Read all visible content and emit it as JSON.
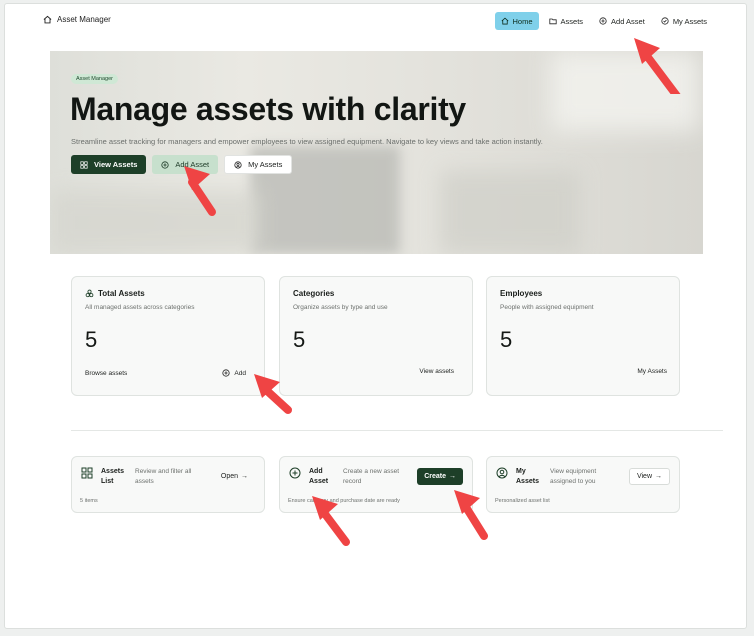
{
  "brand": {
    "name": "Asset Manager",
    "icon": "home-icon"
  },
  "nav": {
    "items": [
      {
        "label": "Home",
        "icon": "home-icon",
        "active": true
      },
      {
        "label": "Assets",
        "icon": "folder-icon",
        "active": false
      },
      {
        "label": "Add Asset",
        "icon": "plus-circle-icon",
        "active": false
      },
      {
        "label": "My Assets",
        "icon": "check-circle-icon",
        "active": false
      }
    ]
  },
  "hero": {
    "tag": "Asset Manager",
    "title": "Manage assets with clarity",
    "subtitle": "Streamline asset tracking for managers and empower employees to view assigned equipment. Navigate to key views and take action instantly.",
    "buttons": {
      "view_assets": "View Assets",
      "add_asset": "Add Asset",
      "my_assets": "My Assets"
    }
  },
  "stats": {
    "total": {
      "title": "Total Assets",
      "desc": "All managed assets across categories",
      "value": "5",
      "link": "Browse assets",
      "action": "Add"
    },
    "categories": {
      "title": "Categories",
      "desc": "Organize assets by type and use",
      "value": "5",
      "link": "View assets"
    },
    "employees": {
      "title": "Employees",
      "desc": "People with assigned equipment",
      "value": "5",
      "link": "My Assets"
    }
  },
  "quick": {
    "list": {
      "name": "Assets List",
      "text": "Review and filter all assets",
      "action": "Open",
      "note": "5 items"
    },
    "add": {
      "name": "Add Asset",
      "text": "Create a new asset record",
      "action": "Create",
      "note": "Ensure category and purchase date are ready"
    },
    "mine": {
      "name": "My Assets",
      "text": "View equipment assigned to you",
      "action": "View",
      "note": "Personalized asset list"
    }
  },
  "colors": {
    "primary_dark": "#1d3f28",
    "nav_active": "#7fd0ea",
    "soft_green": "#c7e0cd",
    "annotation_arrow": "#ef4444"
  }
}
